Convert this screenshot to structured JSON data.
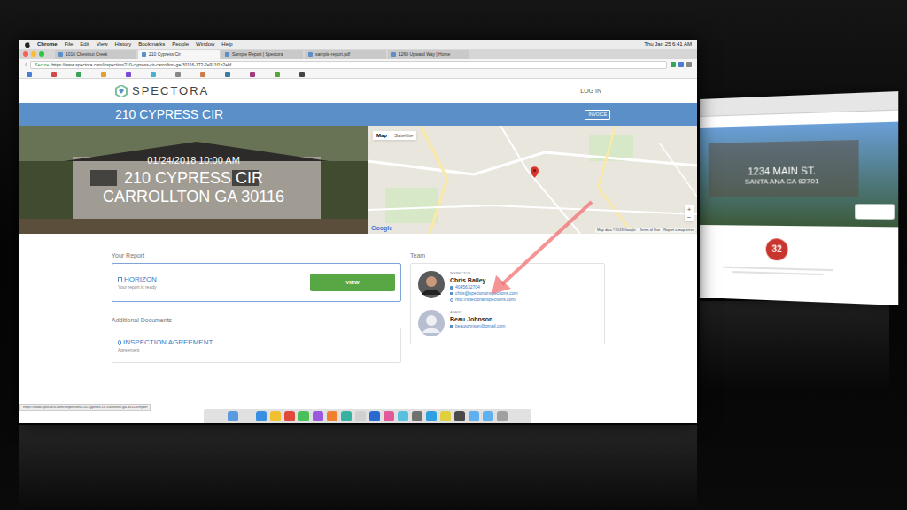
{
  "menubar": {
    "items": [
      "Chrome",
      "File",
      "Edit",
      "View",
      "History",
      "Bookmarks",
      "People",
      "Window",
      "Help"
    ],
    "clock": "Thu Jan 25  6:41 AM"
  },
  "tabs": [
    {
      "label": "1016 Chestnut Creek",
      "selected": false
    },
    {
      "label": "210 Cypress Cir",
      "selected": true
    },
    {
      "label": "Sample Report | Spectora",
      "selected": false
    },
    {
      "label": "sample-report.pdf",
      "selected": false
    },
    {
      "label": "1260 Upward Way | Home",
      "selected": false
    }
  ],
  "address": {
    "secure": "Secure",
    "url": "https://www.spectora.com/inspection/210-cypress-cir-carrollton-ga-30116-172-2e911f1b2ebf"
  },
  "bookmarks": [
    {
      "color": "#4a7fd0"
    },
    {
      "color": "#d04a4a"
    },
    {
      "color": "#3aa35a"
    },
    {
      "color": "#e0a030"
    },
    {
      "color": "#7a4ad0"
    },
    {
      "color": "#4ab0d0"
    },
    {
      "color": "#888888"
    },
    {
      "color": "#d07a4a"
    },
    {
      "color": "#3a7aa3"
    },
    {
      "color": "#a33a7a"
    },
    {
      "color": "#5aa33a"
    },
    {
      "color": "#444444"
    }
  ],
  "site": {
    "logo": "SPECTORA",
    "login": "LOG IN"
  },
  "title_bar": {
    "title": "210 CYPRESS CIR",
    "invoice_button": "INVOICE"
  },
  "hero": {
    "datetime": "01/24/2018 10:00 AM",
    "street": "210 CYPRESS CIR",
    "city": "CARROLLTON GA 30116"
  },
  "map": {
    "tabs": [
      {
        "label": "Map",
        "selected": true
      },
      {
        "label": "Satellite",
        "selected": false
      }
    ],
    "zoom_in": "+",
    "zoom_out": "−",
    "attribution": "Google",
    "footer": [
      "Map data ©2018 Google",
      "Terms of Use",
      "Report a map error"
    ]
  },
  "report": {
    "heading": "Your Report",
    "name": "HORIZON",
    "status": "Your report is ready",
    "button": "VIEW"
  },
  "documents": {
    "heading": "Additional Documents",
    "items": [
      {
        "name": "INSPECTION AGREEMENT",
        "type": "Agreement"
      }
    ]
  },
  "team": {
    "heading": "Team",
    "members": [
      {
        "role": "INSPECTOR",
        "name": "Chris Bailey",
        "phone": "4045632704",
        "email": "chris@spectorainspections.com",
        "website": "http://spectorainspections.com/",
        "kind": "photo"
      },
      {
        "role": "AGENT",
        "name": "Beau Johnson",
        "email": "beaujohnson@gmail.com",
        "kind": "placeholder"
      }
    ]
  },
  "status_url": "https://www.spectora.com/inspection/210-cypress-cir-carrollton-ga-30116/report",
  "dock": [
    {
      "color": "#5a9be0"
    },
    {
      "color": "#e0e0e0"
    },
    {
      "color": "#3a8ee0"
    },
    {
      "color": "#f0c030"
    },
    {
      "color": "#e04a3a"
    },
    {
      "color": "#4ac05a"
    },
    {
      "color": "#9a5ae0"
    },
    {
      "color": "#f08030"
    },
    {
      "color": "#3ab0a0"
    },
    {
      "color": "#d0d0d0"
    },
    {
      "color": "#2a6ad0"
    },
    {
      "color": "#e05a9a"
    },
    {
      "color": "#5ac0e0"
    },
    {
      "color": "#707070"
    },
    {
      "color": "#30a0e0"
    },
    {
      "color": "#e0d040"
    },
    {
      "color": "#4a4a4a"
    },
    {
      "color": "#60b0f0"
    },
    {
      "color": "#60b0f0"
    },
    {
      "color": "#a0a0a0"
    }
  ],
  "second_window": {
    "street": "1234 MAIN ST.",
    "city": "SANTA ANA CA 92701",
    "score": "32"
  }
}
